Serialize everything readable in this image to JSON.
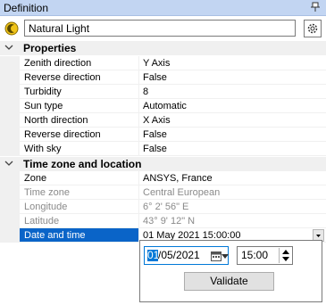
{
  "panel": {
    "title": "Definition",
    "pin_icon": "pin-icon"
  },
  "toolbar": {
    "object_icon": "natural-light-icon",
    "name_value": "Natural Light",
    "settings_icon": "gear-icon"
  },
  "grid": {
    "categories": [
      {
        "label": "Properties"
      },
      {
        "label": "Time zone and location"
      }
    ],
    "properties": [
      {
        "name": "Zenith direction",
        "value": "Y Axis"
      },
      {
        "name": "Reverse direction",
        "value": "False"
      },
      {
        "name": "Turbidity",
        "value": "8"
      },
      {
        "name": "Sun type",
        "value": "Automatic"
      },
      {
        "name": "North direction",
        "value": "X Axis"
      },
      {
        "name": "Reverse direction",
        "value": "False"
      },
      {
        "name": "With sky",
        "value": "False"
      }
    ],
    "location": [
      {
        "name": "Zone",
        "value": "ANSYS, France",
        "enabled": true
      },
      {
        "name": "Time zone",
        "value": "Central European",
        "enabled": false
      },
      {
        "name": "Longitude",
        "value": "6° 2' 56\" E",
        "enabled": false
      },
      {
        "name": "Latitude",
        "value": "43° 9' 12\" N",
        "enabled": false
      },
      {
        "name": "Date and time",
        "value": "01 May 2021 15:00:00",
        "enabled": true,
        "selected": true
      }
    ]
  },
  "popup": {
    "date_selected_segment": "01",
    "date_rest": "/05/2021",
    "time_value": "15:00",
    "validate_label": "Validate"
  },
  "colors": {
    "titlebar": "#c2d5f2",
    "selection": "#0a64c8",
    "category_bg": "#f0f0f0",
    "focus": "#0078d7"
  }
}
